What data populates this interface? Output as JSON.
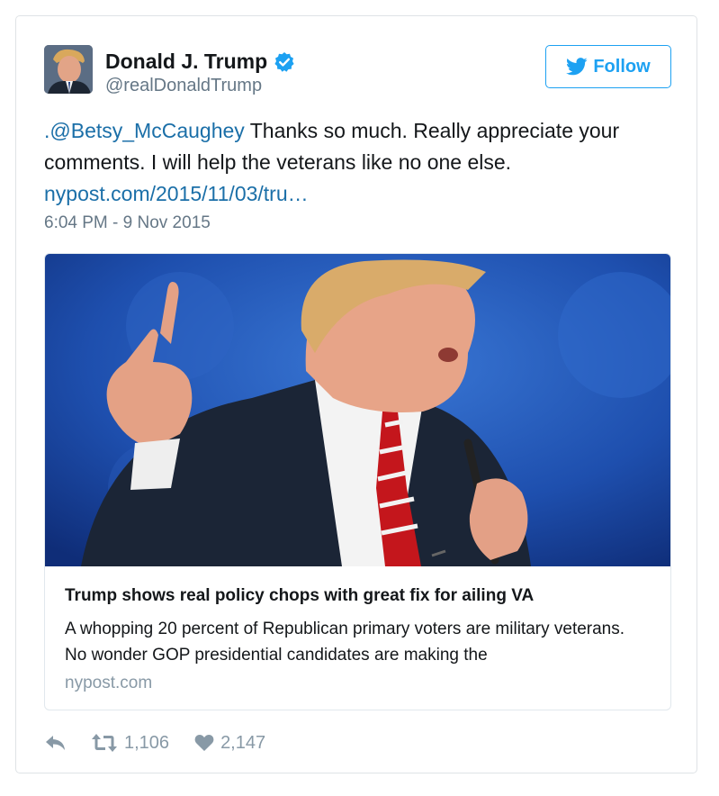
{
  "user": {
    "name": "Donald J. Trump",
    "handle": "@realDonaldTrump",
    "verified_icon": "verified-badge-icon"
  },
  "follow_button": {
    "label": "Follow",
    "icon": "twitter-bird-icon"
  },
  "tweet": {
    "mention": ".@Betsy_McCaughey",
    "text": " Thanks so much. Really appreciate your comments. I will help the veterans like no one else.",
    "link": "nypost.com/2015/11/03/tru…",
    "timestamp": "6:04 PM - 9 Nov 2015"
  },
  "card": {
    "title": "Trump shows real policy chops with great fix for ailing VA",
    "description": "A whopping 20 percent of Republican primary voters are military veterans. No wonder GOP presidential candidates are making the",
    "domain": "nypost.com"
  },
  "actions": {
    "reply_icon": "reply-icon",
    "retweet_icon": "retweet-icon",
    "retweet_count": "1,106",
    "like_icon": "heart-icon",
    "like_count": "2,147"
  },
  "colors": {
    "link": "#1b6fa8",
    "twitter_blue": "#1da1f2",
    "secondary_text": "#657786"
  }
}
